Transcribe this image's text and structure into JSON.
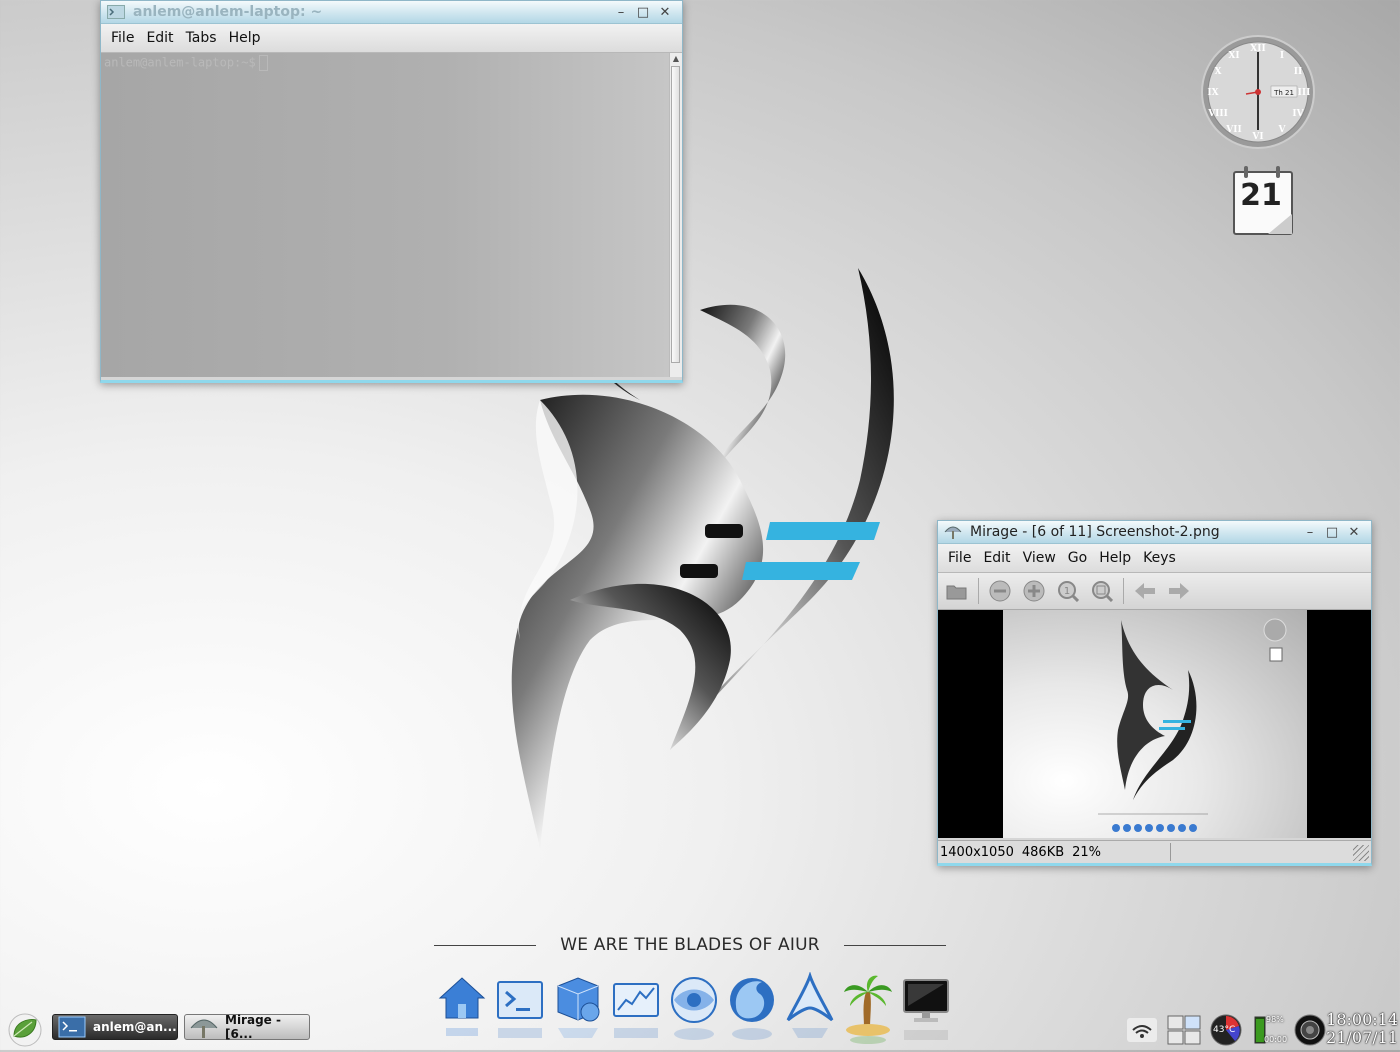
{
  "wallpaper": {
    "slogan": "WE ARE THE BLADES OF AIUR"
  },
  "terminal": {
    "title": "anlem@anlem-laptop: ~",
    "menu": [
      "File",
      "Edit",
      "Tabs",
      "Help"
    ],
    "prompt": "anlem@anlem-laptop:~$"
  },
  "mirage": {
    "title": "Mirage - [6 of 11] Screenshot-2.png",
    "menu": [
      "File",
      "Edit",
      "View",
      "Go",
      "Help",
      "Keys"
    ],
    "toolbar": [
      "open-icon",
      "zoom-out-icon",
      "zoom-in-icon",
      "zoom-100-icon",
      "zoom-fit-icon",
      "previous-icon",
      "next-icon"
    ],
    "status": {
      "dimensions": "1400x1050",
      "filesize": "486KB",
      "zoom": "21%"
    }
  },
  "desklets": {
    "calendar_day": "21",
    "clock_date": "Th 21"
  },
  "taskbar": {
    "tasks": [
      {
        "label": "anlem@an...",
        "icon": "terminal-icon"
      },
      {
        "label": "Mirage - [6...",
        "icon": "mirage-icon"
      }
    ]
  },
  "dock": [
    "home-icon",
    "terminal-icon",
    "packages-icon",
    "system-monitor-icon",
    "browser-icon",
    "firefox-icon",
    "arch-icon",
    "palm-tree-icon",
    "monitor-icon"
  ],
  "tray": {
    "temperature": "43°C",
    "battery_percent": "98%",
    "battery_time": "00:00",
    "time": "18:00:14",
    "date": "21/07/11"
  },
  "colors": {
    "accent": "#35b3e0",
    "titlebar": "#cfe6ef"
  }
}
